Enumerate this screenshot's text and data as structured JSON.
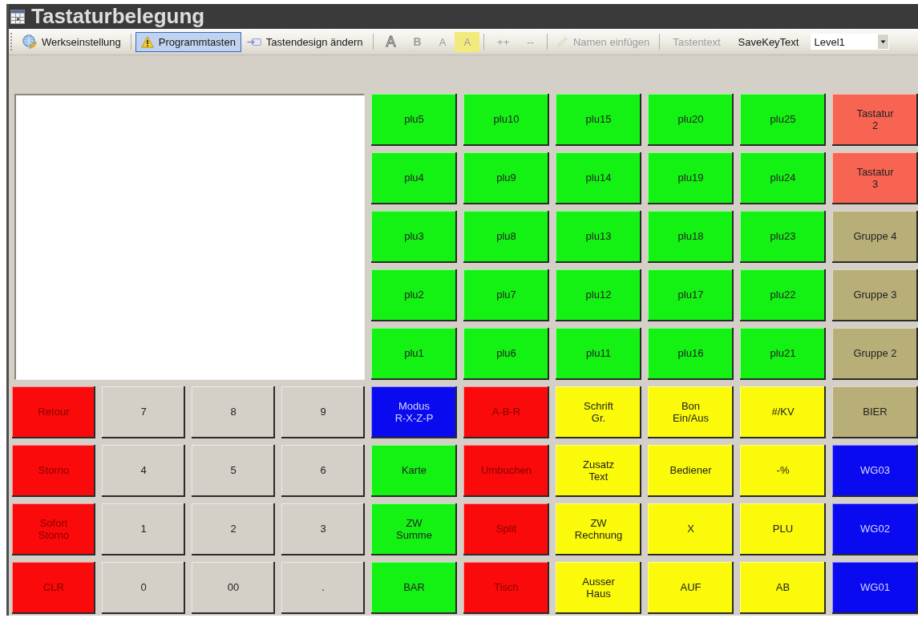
{
  "window": {
    "title": "Tastaturbelegung"
  },
  "toolbar": {
    "groups": [
      [
        {
          "kind": "icon",
          "label": "Werkseinstellung",
          "selected": false,
          "disabled": false
        }
      ],
      [
        {
          "kind": "icon",
          "label": "Programmtasten",
          "selected": true,
          "disabled": false
        },
        {
          "kind": "icon",
          "label": "Tastendesign ändern",
          "selected": false,
          "disabled": false
        }
      ],
      [
        {
          "kind": "outline",
          "label": "A",
          "selected": false,
          "disabled": false
        },
        {
          "kind": "bold",
          "label": "B",
          "selected": false,
          "disabled": true
        },
        {
          "kind": "text",
          "label": "A",
          "selected": false,
          "disabled": true
        },
        {
          "kind": "highlight",
          "label": "A",
          "selected": false,
          "disabled": true
        }
      ],
      [
        {
          "kind": "text",
          "label": "++",
          "selected": false,
          "disabled": true
        },
        {
          "kind": "text",
          "label": "--",
          "selected": false,
          "disabled": true
        }
      ],
      [
        {
          "kind": "icon",
          "label": "Namen einfügen",
          "selected": false,
          "disabled": true
        }
      ],
      [
        {
          "kind": "text",
          "label": "Tastentext",
          "selected": false,
          "disabled": true
        },
        {
          "kind": "text",
          "label": "SaveKeyText",
          "selected": false,
          "disabled": false
        },
        {
          "kind": "combo",
          "value": "Level1",
          "selected": false,
          "disabled": false
        }
      ]
    ]
  },
  "keys": [
    [
      {
        "label": "plu5",
        "color": "#14f214"
      },
      {
        "label": "plu10",
        "color": "#14f214"
      },
      {
        "label": "plu15",
        "color": "#14f214"
      },
      {
        "label": "plu20",
        "color": "#14f214"
      },
      {
        "label": "plu25",
        "color": "#14f214"
      },
      {
        "label": "Tastatur\n2",
        "color": "#f86452"
      }
    ],
    [
      {
        "label": "plu4",
        "color": "#14f214"
      },
      {
        "label": "plu9",
        "color": "#14f214"
      },
      {
        "label": "plu14",
        "color": "#14f214"
      },
      {
        "label": "plu19",
        "color": "#14f214"
      },
      {
        "label": "plu24",
        "color": "#14f214"
      },
      {
        "label": "Tastatur\n3",
        "color": "#f86452"
      }
    ],
    [
      {
        "label": "plu3",
        "color": "#14f214"
      },
      {
        "label": "plu8",
        "color": "#14f214"
      },
      {
        "label": "plu13",
        "color": "#14f214"
      },
      {
        "label": "plu18",
        "color": "#14f214"
      },
      {
        "label": "plu23",
        "color": "#14f214"
      },
      {
        "label": "Gruppe 4",
        "color": "#b8ae78"
      }
    ],
    [
      {
        "label": "plu2",
        "color": "#14f214"
      },
      {
        "label": "plu7",
        "color": "#14f214"
      },
      {
        "label": "plu12",
        "color": "#14f214"
      },
      {
        "label": "plu17",
        "color": "#14f214"
      },
      {
        "label": "plu22",
        "color": "#14f214"
      },
      {
        "label": "Gruppe 3",
        "color": "#b8ae78"
      }
    ],
    [
      {
        "label": "plu1",
        "color": "#14f214"
      },
      {
        "label": "plu6",
        "color": "#14f214"
      },
      {
        "label": "plu11",
        "color": "#14f214"
      },
      {
        "label": "plu16",
        "color": "#14f214"
      },
      {
        "label": "plu21",
        "color": "#14f214"
      },
      {
        "label": "Gruppe 2",
        "color": "#b8ae78"
      }
    ],
    [
      {
        "label": "Retour",
        "color": "#fa0a0a"
      },
      {
        "label": "7",
        "color": "#d4d0c8"
      },
      {
        "label": "8",
        "color": "#d4d0c8"
      },
      {
        "label": "9",
        "color": "#d4d0c8"
      },
      {
        "label": "Modus\nR-X-Z-P",
        "color": "#0a0af0"
      },
      {
        "label": "A-B-R",
        "color": "#fa0a0a"
      },
      {
        "label": "Schrift\nGr.",
        "color": "#fafa0a"
      },
      {
        "label": "Bon\nEin/Aus",
        "color": "#fafa0a"
      },
      {
        "label": "#/KV",
        "color": "#fafa0a"
      },
      {
        "label": "BIER",
        "color": "#b8ae78"
      }
    ],
    [
      {
        "label": "Storno",
        "color": "#fa0a0a"
      },
      {
        "label": "4",
        "color": "#d4d0c8"
      },
      {
        "label": "5",
        "color": "#d4d0c8"
      },
      {
        "label": "6",
        "color": "#d4d0c8"
      },
      {
        "label": "Karte",
        "color": "#14f214"
      },
      {
        "label": "Umbuchen",
        "color": "#fa0a0a"
      },
      {
        "label": "Zusatz\nText",
        "color": "#fafa0a"
      },
      {
        "label": "Bediener",
        "color": "#fafa0a"
      },
      {
        "label": "-%",
        "color": "#fafa0a"
      },
      {
        "label": "WG03",
        "color": "#0a0af0"
      }
    ],
    [
      {
        "label": "Sofort\nStorno",
        "color": "#fa0a0a"
      },
      {
        "label": "1",
        "color": "#d4d0c8"
      },
      {
        "label": "2",
        "color": "#d4d0c8"
      },
      {
        "label": "3",
        "color": "#d4d0c8"
      },
      {
        "label": "ZW\nSumme",
        "color": "#14f214"
      },
      {
        "label": "Split",
        "color": "#fa0a0a"
      },
      {
        "label": "ZW\nRechnung",
        "color": "#fafa0a"
      },
      {
        "label": "X",
        "color": "#fafa0a"
      },
      {
        "label": "PLU",
        "color": "#fafa0a"
      },
      {
        "label": "WG02",
        "color": "#0a0af0"
      }
    ],
    [
      {
        "label": "CLR",
        "color": "#fa0a0a"
      },
      {
        "label": "0",
        "color": "#d4d0c8"
      },
      {
        "label": "00",
        "color": "#d4d0c8"
      },
      {
        "label": ".",
        "color": "#d4d0c8"
      },
      {
        "label": "BAR",
        "color": "#14f214"
      },
      {
        "label": "Tisch",
        "color": "#fa0a0a"
      },
      {
        "label": "Ausser\nHaus",
        "color": "#fafa0a"
      },
      {
        "label": "AUF",
        "color": "#fafa0a"
      },
      {
        "label": "AB",
        "color": "#fafa0a"
      },
      {
        "label": "WG01",
        "color": "#0a0af0"
      }
    ]
  ]
}
